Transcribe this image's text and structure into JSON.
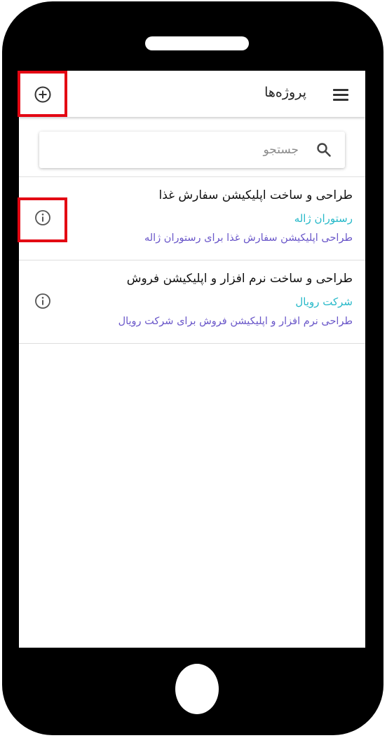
{
  "header": {
    "title": "پروژه‌ها",
    "menu_icon": "menu-icon",
    "add_icon": "add-circle-icon"
  },
  "search": {
    "placeholder": "جستجو",
    "value": "",
    "icon": "search-icon"
  },
  "projects": [
    {
      "title": "طراحی و ساخت اپلیکیشن سفارش غذا",
      "client": "رستوران ژاله",
      "description": "طراحی اپلیکیشن سفارش غذا برای رستوران ژاله",
      "icon": "info-icon"
    },
    {
      "title": "طراحی و ساخت نرم افزار و اپلیکیشن فروش",
      "client": "شرکت رویال",
      "description": "طراحی نرم افزار و اپلیکیشن فروش برای شرکت رویال",
      "icon": "info-icon"
    }
  ],
  "colors": {
    "client_text": "#26b9c9",
    "description_text": "#6a57c9",
    "highlight": "#e30613",
    "device_frame": "#000000"
  }
}
